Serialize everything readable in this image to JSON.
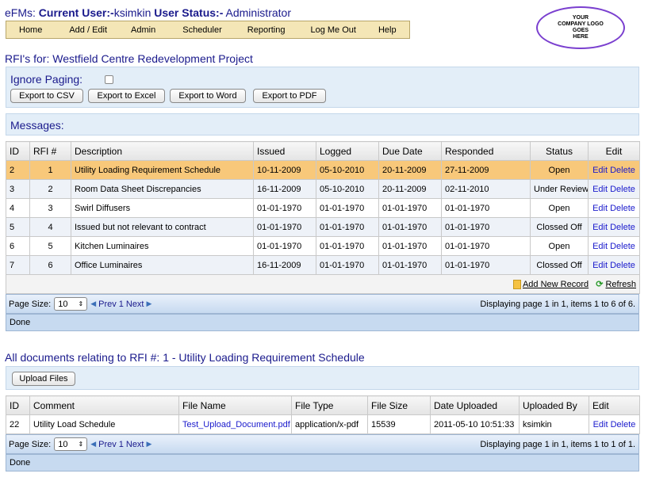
{
  "header": {
    "app": "eFMs:",
    "user_label": "Current User:-",
    "user": "ksimkin",
    "status_label": "User Status:-",
    "status": "Administrator"
  },
  "menu": [
    "Home",
    "Add / Edit",
    "Admin",
    "Scheduler",
    "Reporting",
    "Log Me Out",
    "Help"
  ],
  "logo": {
    "line1": "YOUR",
    "line2": "COMPANY LOGO",
    "line3": "GOES",
    "line4": "HERE"
  },
  "project_title": "RFI's for: Westfield Centre Redevelopment Project",
  "ignore_paging": "Ignore Paging:",
  "export_buttons": [
    "Export to CSV",
    "Export to Excel",
    "Export to Word",
    "Export to PDF"
  ],
  "messages_label": "Messages:",
  "rfi_table": {
    "columns": [
      "ID",
      "RFI #",
      "Description",
      "Issued",
      "Logged",
      "Due Date",
      "Responded",
      "Status",
      "Edit"
    ],
    "rows": [
      {
        "id": "2",
        "rfi": "1",
        "desc": "Utility Loading Requirement Schedule",
        "issued": "10-11-2009",
        "logged": "05-10-2010",
        "due": "20-11-2009",
        "responded": "27-11-2009",
        "status": "Open"
      },
      {
        "id": "3",
        "rfi": "2",
        "desc": "Room Data Sheet Discrepancies",
        "issued": "16-11-2009",
        "logged": "05-10-2010",
        "due": "20-11-2009",
        "responded": "02-11-2010",
        "status": "Under Review"
      },
      {
        "id": "4",
        "rfi": "3",
        "desc": "Swirl Diffusers",
        "issued": "01-01-1970",
        "logged": "01-01-1970",
        "due": "01-01-1970",
        "responded": "01-01-1970",
        "status": "Open"
      },
      {
        "id": "5",
        "rfi": "4",
        "desc": "Issued but not relevant to contract",
        "issued": "01-01-1970",
        "logged": "01-01-1970",
        "due": "01-01-1970",
        "responded": "01-01-1970",
        "status": "Clossed Off"
      },
      {
        "id": "6",
        "rfi": "5",
        "desc": "Kitchen Luminaires",
        "issued": "01-01-1970",
        "logged": "01-01-1970",
        "due": "01-01-1970",
        "responded": "01-01-1970",
        "status": "Open"
      },
      {
        "id": "7",
        "rfi": "6",
        "desc": "Office Luminaires",
        "issued": "16-11-2009",
        "logged": "01-01-1970",
        "due": "01-01-1970",
        "responded": "01-01-1970",
        "status": "Clossed Off"
      }
    ],
    "edit": "Edit",
    "delete": "Delete",
    "add_new": "Add New Record",
    "refresh": "Refresh",
    "page_size_label": "Page Size:",
    "page_size": "10",
    "prev": "Prev",
    "page": "1",
    "next": "Next",
    "displaying": "Displaying page 1 in 1, items 1 to 6 of 6.",
    "status": "Done"
  },
  "docs_title": "All documents relating to RFI #: 1 - Utility Loading Requirement Schedule",
  "upload_button": "Upload Files",
  "doc_table": {
    "columns": [
      "ID",
      "Comment",
      "File Name",
      "File Type",
      "File Size",
      "Date Uploaded",
      "Uploaded By",
      "Edit"
    ],
    "rows": [
      {
        "id": "22",
        "comment": "Utility Load Schedule",
        "file": "Test_Upload_Document.pdf",
        "type": "application/x-pdf",
        "size": "15539",
        "date": "2011-05-10 10:51:33",
        "by": "ksimkin"
      }
    ],
    "edit": "Edit",
    "delete": "Delete",
    "page_size_label": "Page Size:",
    "page_size": "10",
    "prev": "Prev",
    "page": "1",
    "next": "Next",
    "displaying": "Displaying page 1 in 1, items 1 to 1 of 1.",
    "status": "Done"
  },
  "colors": {
    "accent": "#1a1a8c",
    "menu_bg": "#f4e6b6",
    "selected_row": "#f8c87a",
    "panel": "#e3eef8",
    "logo_border": "#7a3fcf"
  }
}
